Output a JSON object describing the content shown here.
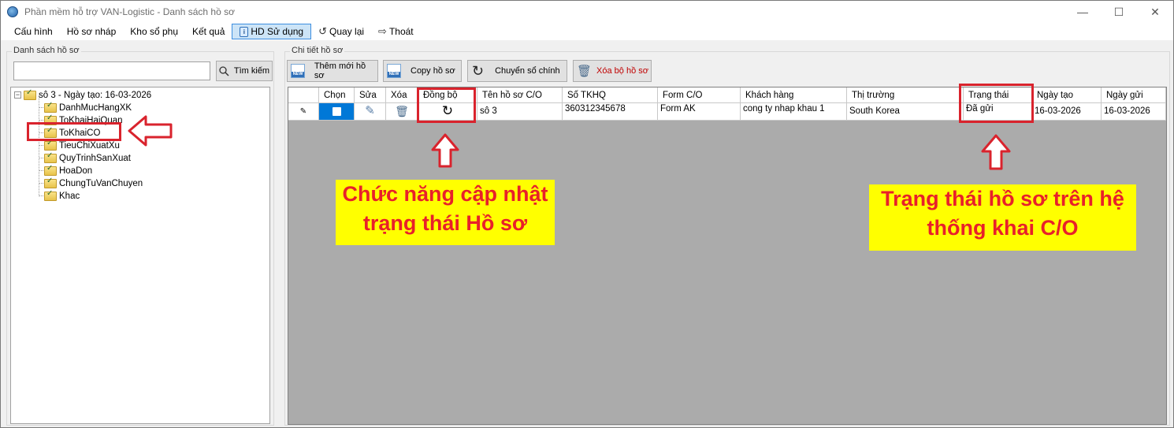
{
  "window": {
    "title": "Phần mềm hỗ trợ VAN-Logistic - Danh sách hồ sơ",
    "controls": [
      "—",
      "☐",
      "✕"
    ]
  },
  "menu": [
    {
      "label": "Cấu hình"
    },
    {
      "label": "Hồ sơ nháp"
    },
    {
      "label": "Kho sổ phụ"
    },
    {
      "label": "Kết quả"
    },
    {
      "label": "HD Sử dụng",
      "icon": "help-doc-icon",
      "active": true
    },
    {
      "label": "Quay lại",
      "icon": "back-refresh-icon"
    },
    {
      "label": "Thoát",
      "icon": "exit-icon"
    }
  ],
  "left_panel": {
    "title": "Danh sách hồ sơ",
    "search_value": "",
    "search_button": "Tìm kiếm",
    "tree": {
      "root": "sô 3 - Ngày tạo: 16-03-2026",
      "children": [
        "DanhMucHangXK",
        "ToKhaiHaiQuan",
        "ToKhaiCO",
        "TieuChiXuatXu",
        "QuyTrinhSanXuat",
        "HoaDon",
        "ChungTuVanChuyen",
        "Khac"
      ]
    }
  },
  "right_panel": {
    "title": "Chi tiết hồ sơ",
    "toolbar": {
      "add": "Thêm mới hồ sơ",
      "copy": "Copy hồ sơ",
      "convert": "Chuyển sổ chính",
      "delete": "Xóa bộ hồ sơ"
    },
    "grid": {
      "columns": [
        "",
        "Chọn",
        "Sửa",
        "Xóa",
        "Đồng bộ",
        "Tên hồ sơ C/O",
        "Số TKHQ",
        "Form C/O",
        "Khách hàng",
        "Thị trường",
        "Trạng thái",
        "Ngày tạo",
        "Ngày gửi"
      ],
      "rows": [
        {
          "name": "sô 3",
          "tkhq": "360312345678",
          "form": "Form AK",
          "customer": "cong ty nhap khau 1",
          "market": "South Korea",
          "status": "Đã gửi",
          "created": "16-03-2026",
          "sent": "16-03-2026"
        }
      ]
    }
  },
  "annotations": {
    "sync_note": [
      "Chức năng cập nhật",
      "trạng thái Hồ sơ"
    ],
    "status_note": [
      "Trạng thái hồ sơ trên hệ",
      "thống khai C/O"
    ],
    "highlight_color": "#d9232d",
    "note_bg": "#ffff00",
    "note_text_color": "#e8202a"
  }
}
